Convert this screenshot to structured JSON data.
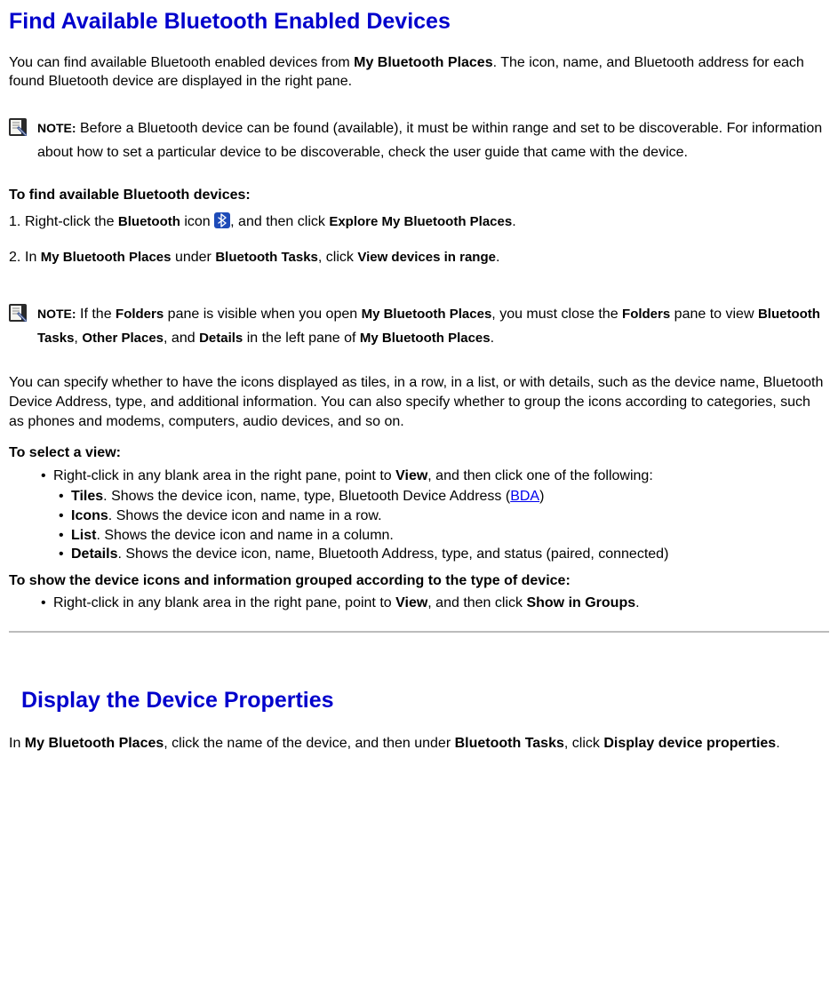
{
  "heading1": "Find Available Bluetooth Enabled Devices",
  "intro": {
    "pre": "You can find available Bluetooth enabled devices from ",
    "bold": "My Bluetooth Places",
    "post": ". The icon, name, and Bluetooth address for each found Bluetooth device are displayed in the right pane."
  },
  "noteLabel": "NOTE:",
  "note1_text": " Before a Bluetooth device can be found (available), it must be within range and set to be discoverable. For information about how to set a particular device to be discoverable, check the user guide that came with the device.",
  "subhead_find": "To find available Bluetooth devices:",
  "step1": {
    "marker": "1.",
    "t1": "Right-click the ",
    "b1": "Bluetooth",
    "t2": " icon ",
    "t3": ", and then click ",
    "b2": "Explore My Bluetooth Places",
    "t4": "."
  },
  "step2": {
    "marker": "2.",
    "t1": "In ",
    "b1": "My Bluetooth Places",
    "t2": " under ",
    "b2": "Bluetooth Tasks",
    "t3": ", click ",
    "b3": "View devices in range",
    "t4": "."
  },
  "note2": {
    "t1": " If the ",
    "b1": "Folders",
    "t2": " pane is visible when you open ",
    "b2": "My Bluetooth Places",
    "t3": ", you must close the ",
    "b3": "Folders",
    "t4": " pane to view ",
    "b4": "Bluetooth Tasks",
    "t5": ", ",
    "b5": "Other Places",
    "t6": ", and ",
    "b6": "Details",
    "t7": " in the left pane of ",
    "b7": "My Bluetooth Places",
    "t8": "."
  },
  "para_views": "You can specify whether to have the icons displayed as tiles, in a row, in a list, or with details, such as the device name, Bluetooth Device Address, type, and additional information. You can also specify whether to group the icons according to categories, such as phones and modems, computers, audio devices, and so on.",
  "subhead_select": "To select a view:",
  "view_intro": {
    "t1": "Right-click in any blank area in the right pane, point to ",
    "b1": "View",
    "t2": ", and then click one of the following:"
  },
  "views": {
    "tiles": {
      "name": "Tiles",
      "desc_a": ". Shows the device icon, name, type, Bluetooth Device Address (",
      "link": "BDA",
      "desc_b": ")"
    },
    "icons": {
      "name": "Icons",
      "desc": ". Shows the device icon and name in a row."
    },
    "list": {
      "name": "List",
      "desc": ". Shows the device icon and name in a column."
    },
    "details": {
      "name": "Details",
      "desc": ". Shows the device icon, name, Bluetooth Address, type, and status (paired, connected)"
    }
  },
  "subhead_group": "To show the device icons and information grouped according to the type of device:",
  "group_step": {
    "t1": "Right-click in any blank area in the right pane, point to ",
    "b1": "View",
    "t2": ", and then click ",
    "b2": "Show in Groups",
    "t3": "."
  },
  "heading2": "Display the Device Properties",
  "props_para": {
    "t1": "In ",
    "b1": "My Bluetooth Places",
    "t2": ", click the name of the device, and then under ",
    "b2": "Bluetooth Tasks",
    "t3": ", click ",
    "b3": "Display device properties",
    "t4": "."
  },
  "bullet": "•"
}
